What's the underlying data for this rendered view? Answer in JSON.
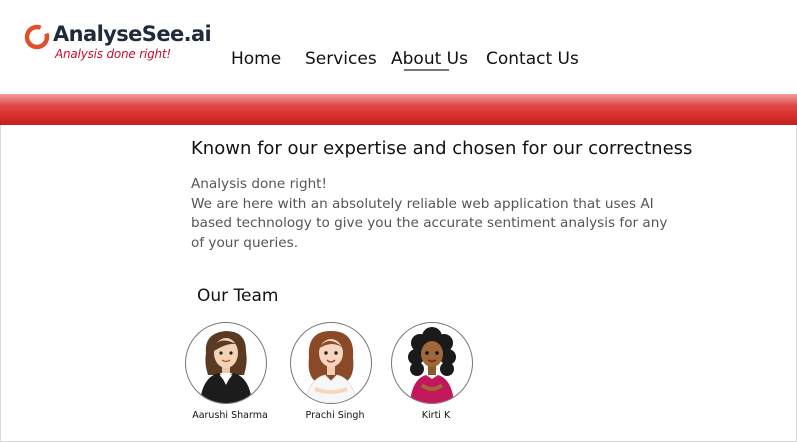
{
  "brand": {
    "name": "AnalyseSee.ai",
    "tagline": "Analysis done right!"
  },
  "nav": {
    "items": [
      {
        "label": "Home"
      },
      {
        "label": "Services"
      },
      {
        "label": "About Us",
        "active": true
      },
      {
        "label": "Contact Us"
      }
    ]
  },
  "colors": {
    "accent": "#d42a2a",
    "logo_ring": "#e0502a"
  },
  "about": {
    "headline": "Known for our expertise and chosen for our correctness",
    "intro": "Analysis done right!",
    "description": "We are here with an absolutely reliable web application that uses AI based technology to give you the accurate sentiment analysis for any of your queries."
  },
  "team": {
    "title": "Our Team",
    "members": [
      {
        "name": "Aarushi Sharma",
        "icon": "avatar-woman-blazer"
      },
      {
        "name": "Prachi Singh",
        "icon": "avatar-woman-white-top"
      },
      {
        "name": "Kirti K",
        "icon": "avatar-woman-curly-hair"
      }
    ]
  }
}
